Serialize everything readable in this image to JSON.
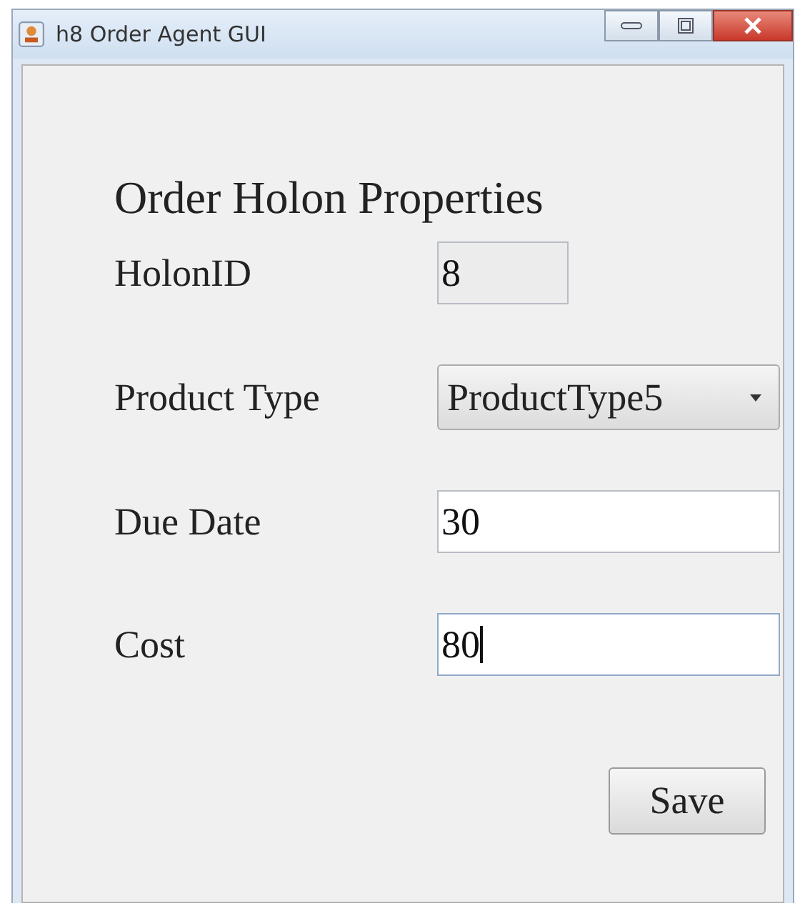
{
  "window": {
    "title": "h8 Order Agent GUI"
  },
  "heading": "Order Holon Properties",
  "fields": [
    {
      "label": "HolonID",
      "kind": "text",
      "value": "8",
      "disabled": true,
      "focused": false
    },
    {
      "label": "Product Type",
      "kind": "dropdown",
      "value": "ProductType5",
      "disabled": false
    },
    {
      "label": "Due Date",
      "kind": "text",
      "value": "30",
      "disabled": false,
      "focused": false
    },
    {
      "label": "Cost",
      "kind": "text",
      "value": "80",
      "disabled": false,
      "focused": true
    }
  ],
  "buttons": [
    {
      "label": "Save"
    }
  ]
}
